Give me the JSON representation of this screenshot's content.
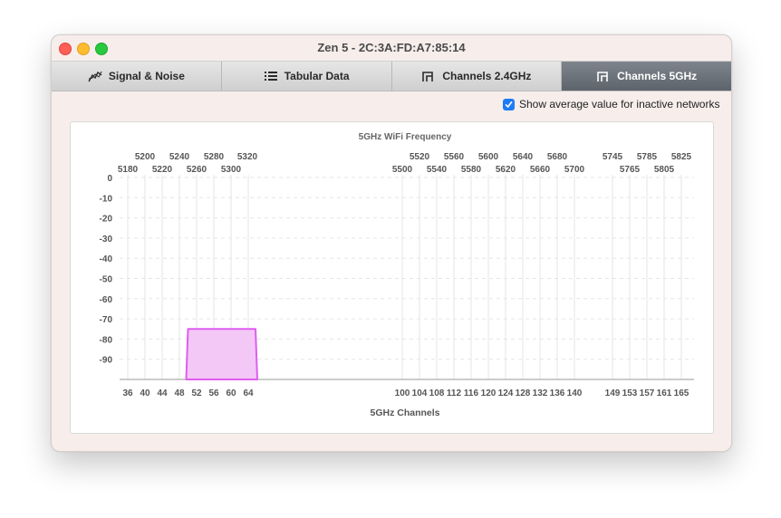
{
  "window": {
    "title": "Zen 5 - 2C:3A:FD:A7:85:14"
  },
  "tabs": [
    {
      "label": "Signal & Noise",
      "icon": "graph-icon",
      "active": false
    },
    {
      "label": "Tabular Data",
      "icon": "list-icon",
      "active": false
    },
    {
      "label": "Channels 2.4GHz",
      "icon": "channel-icon",
      "active": false
    },
    {
      "label": "Channels 5GHz",
      "icon": "channel-icon",
      "active": true
    }
  ],
  "options": {
    "show_average_label": "Show average value for inactive networks",
    "show_average_checked": true
  },
  "chart_data": {
    "type": "area",
    "title": "5GHz WiFi Frequency",
    "xlabel": "5GHz Channels",
    "ylim": [
      -100,
      0
    ],
    "yticks": [
      "0",
      "-10",
      "-20",
      "-30",
      "-40",
      "-50",
      "-60",
      "-70",
      "-80",
      "-90"
    ],
    "grid": true,
    "channels": [
      "36",
      "40",
      "44",
      "48",
      "52",
      "56",
      "60",
      "64",
      "100",
      "104",
      "108",
      "112",
      "116",
      "120",
      "124",
      "128",
      "132",
      "136",
      "140",
      "149",
      "153",
      "157",
      "161",
      "165"
    ],
    "freq_top": [
      "5200",
      "5240",
      "5280",
      "5320",
      "5520",
      "5560",
      "5600",
      "5640",
      "5680",
      "5745",
      "5785",
      "5825"
    ],
    "freq_bottom": [
      "5180",
      "5220",
      "5260",
      "5300",
      "5500",
      "5540",
      "5580",
      "5620",
      "5660",
      "5700",
      "5765",
      "5805"
    ],
    "series": [
      {
        "start_channel": 50,
        "end_channel": 64,
        "signal": -75,
        "color": "#df5df0",
        "fill": "#f3c8f7"
      }
    ]
  }
}
